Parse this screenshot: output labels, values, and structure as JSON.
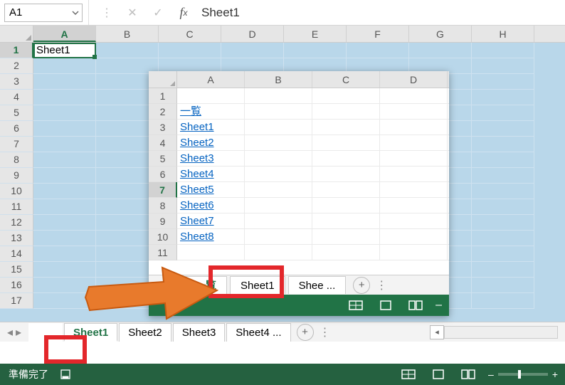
{
  "formula_bar": {
    "namebox": "A1",
    "value": "Sheet1"
  },
  "main_grid": {
    "columns": [
      "A",
      "B",
      "C",
      "D",
      "E",
      "F",
      "G",
      "H"
    ],
    "rows": [
      1,
      2,
      3,
      4,
      5,
      6,
      7,
      8,
      9,
      10,
      11,
      12,
      13,
      14,
      15,
      16,
      17
    ],
    "active_cell_value": "Sheet1"
  },
  "main_tabs": {
    "items": [
      "Sheet1",
      "Sheet2",
      "Sheet3",
      "Sheet4 ..."
    ],
    "active_index": 0
  },
  "status": {
    "text": "準備完了"
  },
  "inset": {
    "columns": [
      "A",
      "B",
      "C",
      "D"
    ],
    "rows": [
      1,
      2,
      3,
      4,
      5,
      6,
      7,
      8,
      9,
      10,
      11
    ],
    "active_row": 7,
    "links": [
      "",
      "一覧",
      "Sheet1",
      "Sheet2",
      "Sheet3",
      "Sheet4",
      "Sheet5",
      "Sheet6",
      "Sheet7",
      "Sheet8",
      ""
    ],
    "tabs": {
      "items": [
        "一覧",
        "Sheet1",
        "Shee ..."
      ],
      "active_index": 0
    }
  }
}
